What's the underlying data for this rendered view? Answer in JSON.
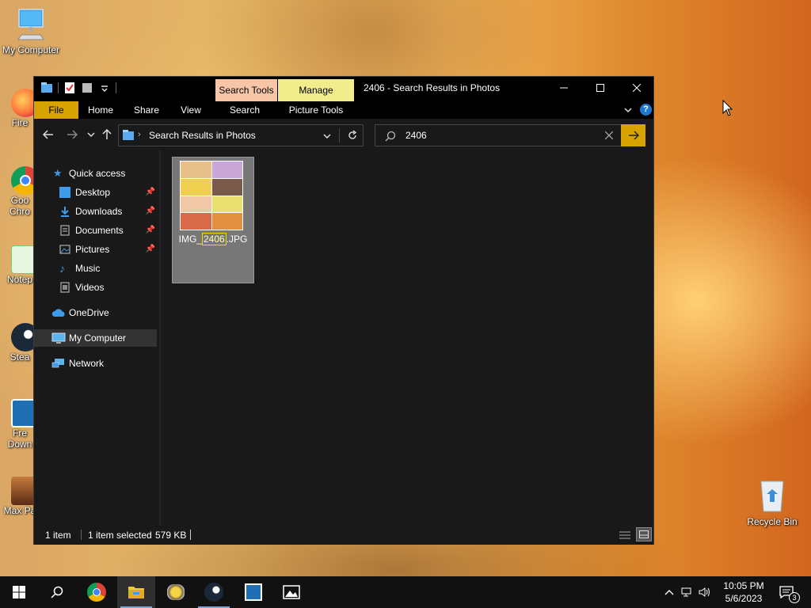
{
  "desktop": {
    "icons": [
      {
        "label": "My Computer"
      },
      {
        "label": "Fire"
      },
      {
        "label": "Goo"
      },
      {
        "label": "Chro"
      },
      {
        "label": "Notep"
      },
      {
        "label": "Stea"
      },
      {
        "label": "Fre"
      },
      {
        "label": "Down"
      },
      {
        "label": "Max Pa"
      },
      {
        "label": "Recycle Bin"
      }
    ]
  },
  "window": {
    "title": "2406 - Search Results in Photos",
    "context_tabs": {
      "search_tools": "Search Tools",
      "manage": "Manage"
    },
    "ribbon_tabs": [
      "File",
      "Home",
      "Share",
      "View",
      "Search",
      "Picture Tools"
    ],
    "address": {
      "path": "Search Results in Photos"
    },
    "search": {
      "value": "2406"
    },
    "nav": {
      "quick_access": "Quick access",
      "items": [
        "Desktop",
        "Downloads",
        "Documents",
        "Pictures",
        "Music",
        "Videos"
      ],
      "onedrive": "OneDrive",
      "my_computer": "My Computer",
      "network": "Network"
    },
    "file": {
      "name_prefix": "IMG_",
      "name_match": "2406",
      "name_suffix": ".JPG"
    },
    "status": {
      "count": "1 item",
      "selected": "1 item selected",
      "size": "579 KB"
    }
  },
  "taskbar": {
    "time": "10:05 PM",
    "date": "5/6/2023",
    "notifications": "3"
  },
  "colors": {
    "search_tab": "#f7c6a8",
    "manage_tab": "#f1ec8c",
    "file_tab": "#d7a300",
    "selection": "#777777",
    "highlight": "#e8e000"
  }
}
